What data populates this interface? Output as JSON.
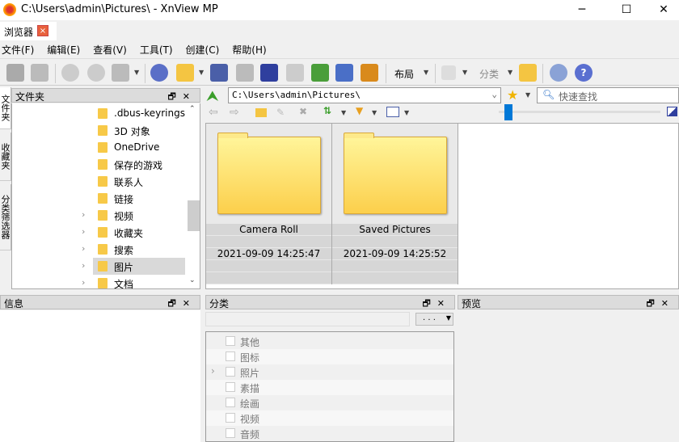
{
  "window": {
    "title": "C:\\Users\\admin\\Pictures\\ - XnView MP",
    "minimize": "─",
    "maximize": "☐",
    "close": "✕"
  },
  "tabs": [
    {
      "label": "浏览器",
      "close": "×"
    }
  ],
  "menu": [
    "文件(F)",
    "编辑(E)",
    "查看(V)",
    "工具(T)",
    "创建(C)",
    "帮助(H)"
  ],
  "toolbar": {
    "layout_label": "布局",
    "category_label": "分类"
  },
  "side_tabs": [
    "文件夹",
    "收藏夹",
    "分类筛选器"
  ],
  "folder_panel": {
    "title": "文件夹",
    "float": "🗗",
    "close": "✕",
    "items": [
      {
        "label": ".dbus-keyrings",
        "expandable": false
      },
      {
        "label": "3D 对象",
        "expandable": false
      },
      {
        "label": "OneDrive",
        "expandable": false
      },
      {
        "label": "保存的游戏",
        "expandable": false
      },
      {
        "label": "联系人",
        "expandable": false
      },
      {
        "label": "链接",
        "expandable": false
      },
      {
        "label": "视频",
        "expandable": true
      },
      {
        "label": "收藏夹",
        "expandable": true
      },
      {
        "label": "搜索",
        "expandable": true
      },
      {
        "label": "图片",
        "expandable": true,
        "selected": true
      },
      {
        "label": "文档",
        "expandable": true
      }
    ]
  },
  "address": {
    "path": "C:\\Users\\admin\\Pictures\\",
    "search_placeholder": "快速查找"
  },
  "thumbnails": [
    {
      "name": "Camera Roll",
      "date": "2021-09-09 14:25:47"
    },
    {
      "name": "Saved Pictures",
      "date": "2021-09-09 14:25:52"
    }
  ],
  "info_panel": {
    "title": "信息"
  },
  "category_panel": {
    "title": "分类",
    "dropdown": ". . .",
    "items": [
      {
        "label": "其他"
      },
      {
        "label": "图标"
      },
      {
        "label": "照片",
        "expandable": true
      },
      {
        "label": "素描"
      },
      {
        "label": "绘画"
      },
      {
        "label": "视频"
      },
      {
        "label": "音频"
      }
    ]
  },
  "preview_panel": {
    "title": "预览"
  },
  "thumbnail_size_slider": 0.0,
  "colors": {
    "selection": "#d9d9d9",
    "slider": "#0078d7",
    "folder": "#fccf4b"
  }
}
